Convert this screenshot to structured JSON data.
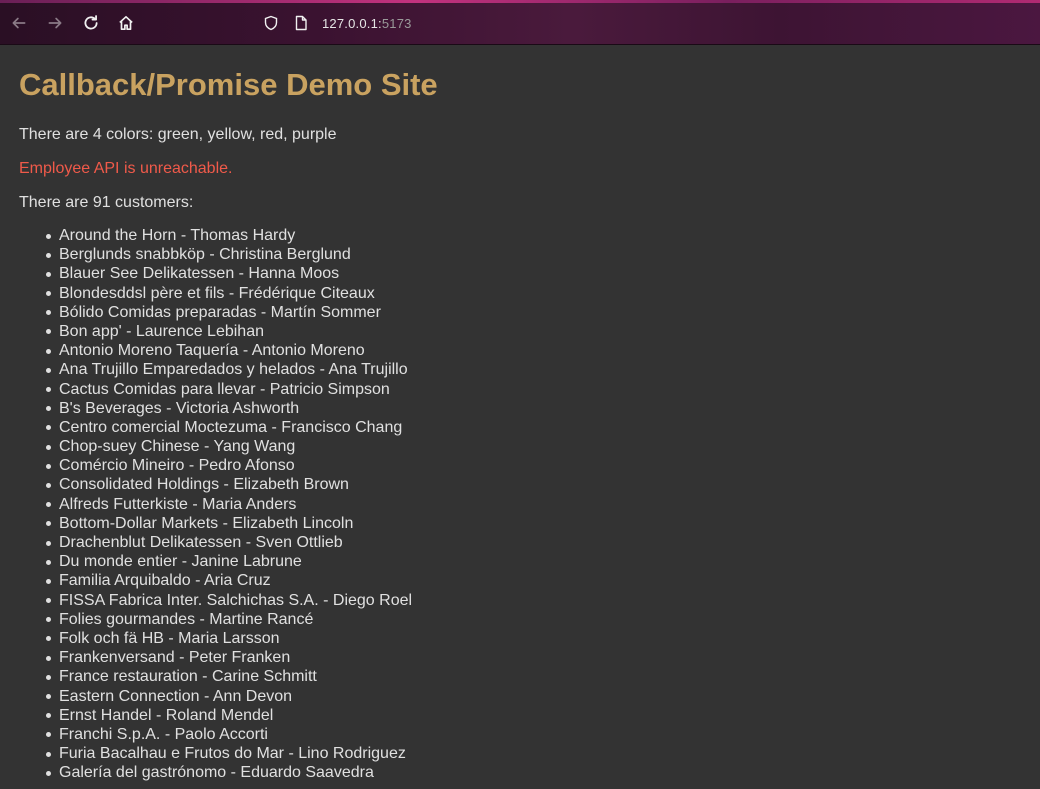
{
  "browser": {
    "url_host": "127.0.0.1:",
    "url_port": "5173"
  },
  "page": {
    "title": "Callback/Promise Demo Site",
    "colors_text": "There are 4 colors: green, yellow, red, purple",
    "employee_error": "Employee API is unreachable.",
    "customers_text": "There are 91 customers:"
  },
  "colors": {
    "title": "#c9a260",
    "error": "#f05a4a",
    "background": "#333333"
  },
  "customers": [
    "Around the Horn - Thomas Hardy",
    "Berglunds snabbköp - Christina Berglund",
    "Blauer See Delikatessen - Hanna Moos",
    "Blondesddsl père et fils - Frédérique Citeaux",
    "Bólido Comidas preparadas - Martín Sommer",
    "Bon app' - Laurence Lebihan",
    "Antonio Moreno Taquería - Antonio Moreno",
    "Ana Trujillo Emparedados y helados - Ana Trujillo",
    "Cactus Comidas para llevar - Patricio Simpson",
    "B's Beverages - Victoria Ashworth",
    "Centro comercial Moctezuma - Francisco Chang",
    "Chop-suey Chinese - Yang Wang",
    "Comércio Mineiro - Pedro Afonso",
    "Consolidated Holdings - Elizabeth Brown",
    "Alfreds Futterkiste - Maria Anders",
    "Bottom-Dollar Markets - Elizabeth Lincoln",
    "Drachenblut Delikatessen - Sven Ottlieb",
    "Du monde entier - Janine Labrune",
    "Familia Arquibaldo - Aria Cruz",
    "FISSA Fabrica Inter. Salchichas S.A. - Diego Roel",
    "Folies gourmandes - Martine Rancé",
    "Folk och fä HB - Maria Larsson",
    "Frankenversand - Peter Franken",
    "France restauration - Carine Schmitt",
    "Eastern Connection - Ann Devon",
    "Ernst Handel - Roland Mendel",
    "Franchi S.p.A. - Paolo Accorti",
    "Furia Bacalhau e Frutos do Mar - Lino Rodriguez",
    "Galería del gastrónomo - Eduardo Saavedra"
  ]
}
